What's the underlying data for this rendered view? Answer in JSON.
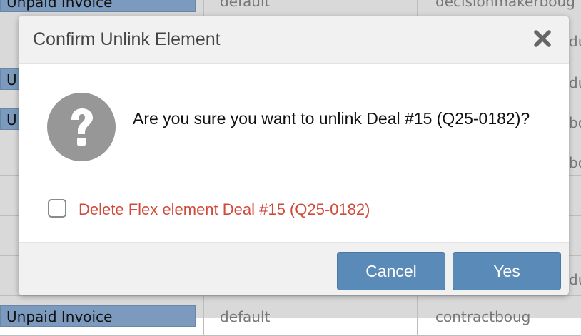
{
  "background": {
    "rows": [
      {
        "col1": "Unpaid Invoice",
        "col2": "default",
        "col3": "decisionmakerboug"
      },
      {
        "col1": "",
        "col2": "",
        "col3": "du"
      },
      {
        "col1": "U",
        "col2": "",
        "col3": "du"
      },
      {
        "col1": "U",
        "col2": "",
        "col3": "boug"
      },
      {
        "col1": "",
        "col2": "",
        "col3": "boug"
      },
      {
        "col1": "",
        "col2": "",
        "col3": ""
      },
      {
        "col1": "",
        "col2": "",
        "col3": ""
      },
      {
        "col1": "",
        "col2": "",
        "col3": "du"
      },
      {
        "col1": "Unpaid Invoice",
        "col2": "default",
        "col3": "contractboug"
      }
    ]
  },
  "modal": {
    "title": "Confirm Unlink Element",
    "question": "Are you sure you want to unlink Deal #15 (Q25-0182)?",
    "checkbox_label": "Delete Flex element Deal #15 (Q25-0182)",
    "checkbox_checked": false,
    "cancel_label": "Cancel",
    "yes_label": "Yes",
    "icons": {
      "close": "close-icon",
      "question": "question-circle-icon"
    }
  },
  "colors": {
    "primary_button": "#5a8ab7",
    "warning_text": "#d04a3a",
    "icon_gray": "#979797"
  }
}
